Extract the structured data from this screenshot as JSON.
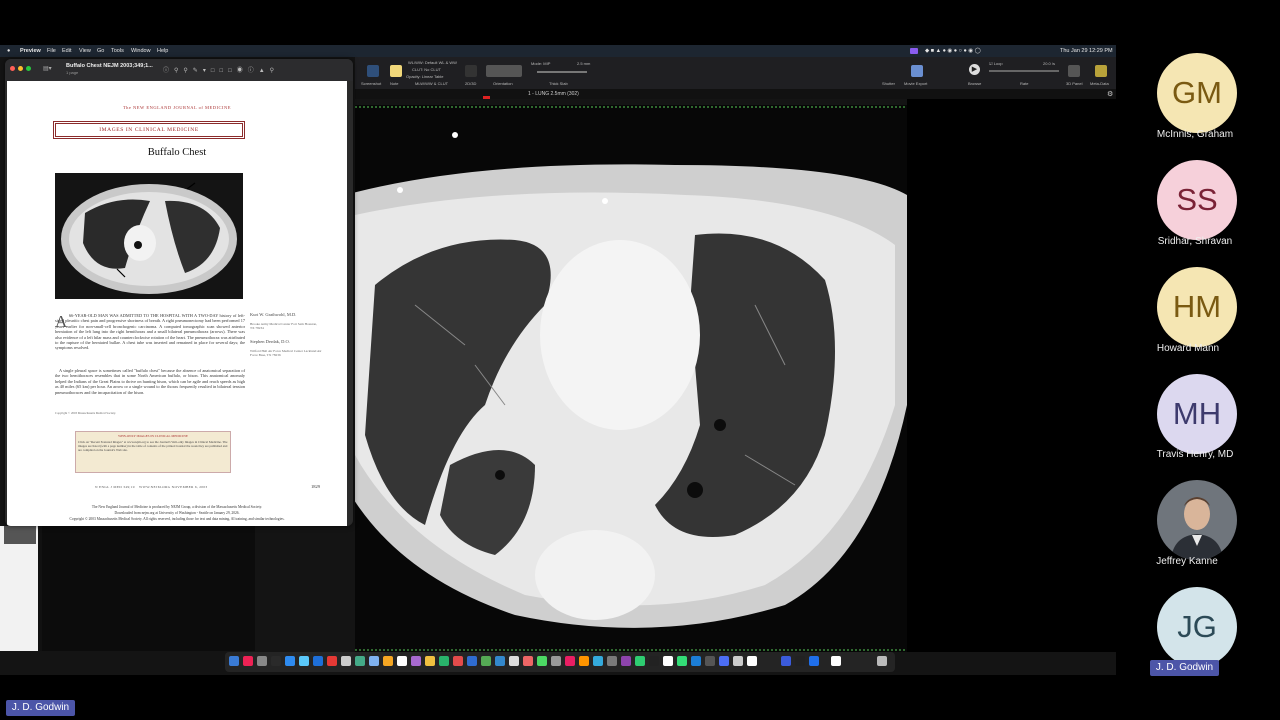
{
  "menubar": {
    "app": "Preview",
    "items": [
      "File",
      "Edit",
      "View",
      "Go",
      "Tools",
      "Window",
      "Help"
    ],
    "clock": "Thu Jan 29  12:29 PM"
  },
  "preview_window": {
    "title": "Buffalo Chest NEJM 2003;349;1...",
    "subtitle": "1 page",
    "journal": "The NEW ENGLAND JOURNAL of MEDICINE",
    "banner": "IMAGES IN CLINICAL MEDICINE",
    "article_title": "Buffalo Chest",
    "drop_cap": "A",
    "body_p1": "66-YEAR-OLD MAN WAS ADMITTED TO THE HOSPITAL WITH A TWO-DAY history of left-sided pleuritic chest pain and progressive shortness of breath. A right pneumonectomy had been performed 17 years earlier for non-small-cell bronchogenic carcinoma. A computed tomographic scan showed anterior herniation of the left lung into the right hemithorax and a small bilateral pneumothorax (arrows). There was also evidence of a left hilar mass and counterclockwise rotation of the heart. The pneumothorax was attributed to the rupture of the herniated bullae. A chest tube was inserted and remained in place for several days; the symptoms resolved.",
    "body_p2": "A single pleural space is sometimes called \"buffalo chest\" because the absence of anatomical separation of the two hemithoraces resembles that in some North American buffalo, or bison. This anatomical anomaly helped the Indians of the Great Plains to thrive on hunting bison, which can be agile and reach speeds as high as 40 miles (65 km) per hour. An arrow or a single wound to the thorax frequently resulted in bilateral tension pneumothoraces and the incapacitation of the bison.",
    "copyright_small": "Copyright © 2003 Massachusetts Medical Society.",
    "author1": "Kurt W. Grathwohl, M.D.",
    "author1_aff": "Brooke Army Medical Center Fort Sam Houston, TX 78234",
    "author2": "Stephen Derdak, D.O.",
    "author2_aff": "Wilford Hall Air Force Medical Center Lackland Air Force Base, TX 78236",
    "web_box_title": "WEB-ONLY IMAGES IN CLINICAL MEDICINE",
    "web_box_text": "Click on \"Recent Featured Images\" at www.nejm.org to see the Journal's Web-only Images in Clinical Medicine. The images are listed (with a page number) in the table of contents of the printed Journal the week they are published and are compiled on the Journal's Web site.",
    "footer_left": "N ENGL J MED 349;19",
    "footer_mid": "WWW.NEJM.ORG   NOVEMBER 6, 2003",
    "page_number": "1829",
    "footer_line1": "The New England Journal of Medicine is produced by NEJM Group, a division of the Massachusetts Medical Society.",
    "footer_line2": "Downloaded from nejm.org at University of Washington - Seattle on January 29, 2026.",
    "footer_line3": "Copyright © 2003 Massachusetts Medical Society. All rights reserved, including those for text and data mining, AI training, and similar technologies."
  },
  "toolbar": {
    "labels": [
      "Screenshot",
      "Note",
      "MLW/WW & CLUT",
      "2D/3D",
      "Orientation",
      "Thick Slab",
      "Shutter",
      "Movie Export",
      "Browse",
      "Rate",
      "3D Panel",
      "Meta-Data"
    ],
    "wlww_label": "WL/WW:",
    "wlww_value": "Default WL & WW",
    "clut_label": "CLUT:",
    "clut_value": "No CLUT",
    "opacity_label": "Opacity:",
    "opacity_value": "Linear Table",
    "mode_label": "Mode:",
    "mode_value": "MIP",
    "thickness": "2.5 mm",
    "loop_label": "Loop",
    "rate_value": "20.0 /s"
  },
  "series_label": "1 - LUNG 2.5mm (302)",
  "participants": [
    {
      "initials": "GM",
      "name": "McInnis, Graham",
      "bg": "#f5e6b3",
      "fg": "#7a5a12"
    },
    {
      "initials": "SS",
      "name": "Sridhar, Shravan",
      "bg": "#f6d0da",
      "fg": "#7a2236"
    },
    {
      "initials": "HM",
      "name": "Howard Mann",
      "bg": "#f5e6b3",
      "fg": "#7a5a12"
    },
    {
      "initials": "MH",
      "name": "Travis Henry, MD",
      "bg": "#dcd8ef",
      "fg": "#3d3a6d"
    },
    {
      "initials": "",
      "name": "Jeffrey Kanne",
      "bg": "#7a7f86",
      "fg": "#fff"
    },
    {
      "initials": "JG",
      "name": "",
      "bg": "#d3e4ea",
      "fg": "#2c4a57"
    }
  ],
  "active_speaker": "J. D. Godwin",
  "self_view": "J. D. Godwin",
  "colors": {
    "zoom_name_chip": "#4c55a8",
    "page_background": "#000000"
  }
}
